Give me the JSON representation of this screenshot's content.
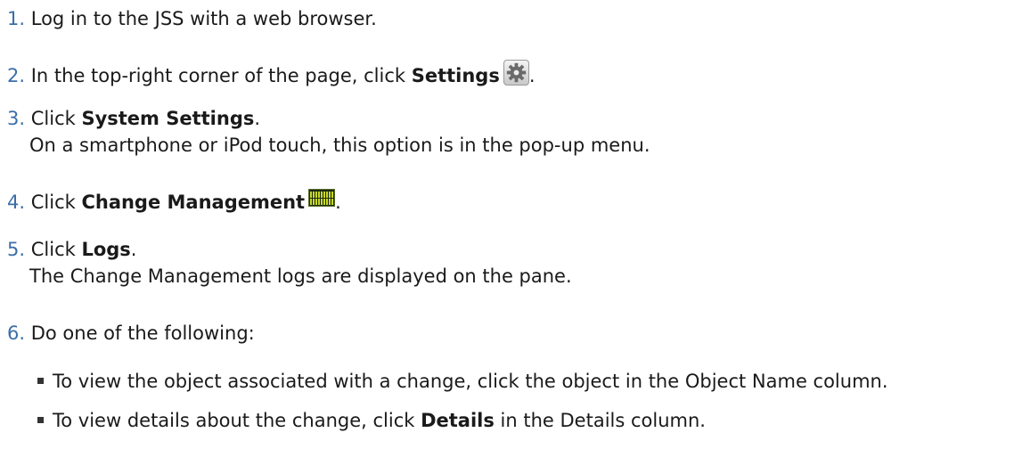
{
  "steps": [
    {
      "num": "1.",
      "text": "Log in to the JSS with a web browser."
    },
    {
      "num": "2.",
      "pre": "In the top-right corner of the page, click ",
      "bold": "Settings",
      "post": "."
    },
    {
      "num": "3.",
      "pre": "Click ",
      "bold": "System Settings",
      "post": ".",
      "sub": "On a smartphone or iPod touch, this option is in the pop-up menu."
    },
    {
      "num": "4.",
      "pre": "Click ",
      "bold": "Change Management",
      "post": "."
    },
    {
      "num": "5.",
      "pre": "Click ",
      "bold": "Logs",
      "post": ".",
      "sub": "The Change Management logs are displayed on the pane."
    },
    {
      "num": "6.",
      "text": "Do one of the following:"
    }
  ],
  "bullets": [
    {
      "text": "To view the object associated with a change, click the object in the Object Name column."
    },
    {
      "pre": "To view details about the change, click ",
      "bold": "Details",
      "post": " in the Details column."
    }
  ],
  "icons": {
    "settings": "gear-icon",
    "change_management": "change-management-icon"
  }
}
